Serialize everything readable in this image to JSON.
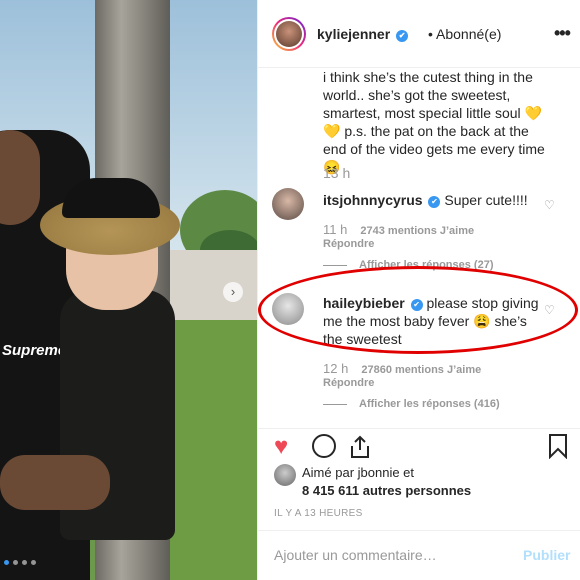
{
  "header": {
    "username": "kyliejenner",
    "verified": "✔",
    "follow_status": "• Abonné(e)",
    "more": "•••"
  },
  "caption": {
    "text": "i think she’s the cutest thing in the world.. she’s got the sweetest, smartest, most special little soul",
    "emoji_hearts": "💛💛",
    "ps": "p.s. the pat on the back at the end of the video gets me every time 😖",
    "time": "13 h"
  },
  "comments": [
    {
      "username": "itsjohnnycyrus",
      "verified": "✔",
      "text": "Super cute!!!!",
      "time": "11 h",
      "likes": "2743 mentions J’aime",
      "reply": "Répondre",
      "replies": "Afficher les réponses (27)"
    },
    {
      "username": "haileybieber",
      "verified": "✔",
      "text": "please stop giving me the most baby fever 😩 she’s the sweetest",
      "time": "12 h",
      "likes": "27860 mentions J’aime",
      "reply": "Répondre",
      "replies": "Afficher les réponses (416)"
    }
  ],
  "likes": {
    "line1": "Aimé par jbonnie et",
    "line2": "8 415 611 autres personnes"
  },
  "post_time": "IL Y A 13 HEURES",
  "add_comment": {
    "placeholder": "Ajouter un commentaire…",
    "publish": "Publier"
  },
  "photo": {
    "shirt_text": "Supreme",
    "arrow": "›"
  },
  "colors": {
    "accent_blue": "#3897f0",
    "like_red": "#ed4956",
    "annotation_red": "#e10000"
  }
}
